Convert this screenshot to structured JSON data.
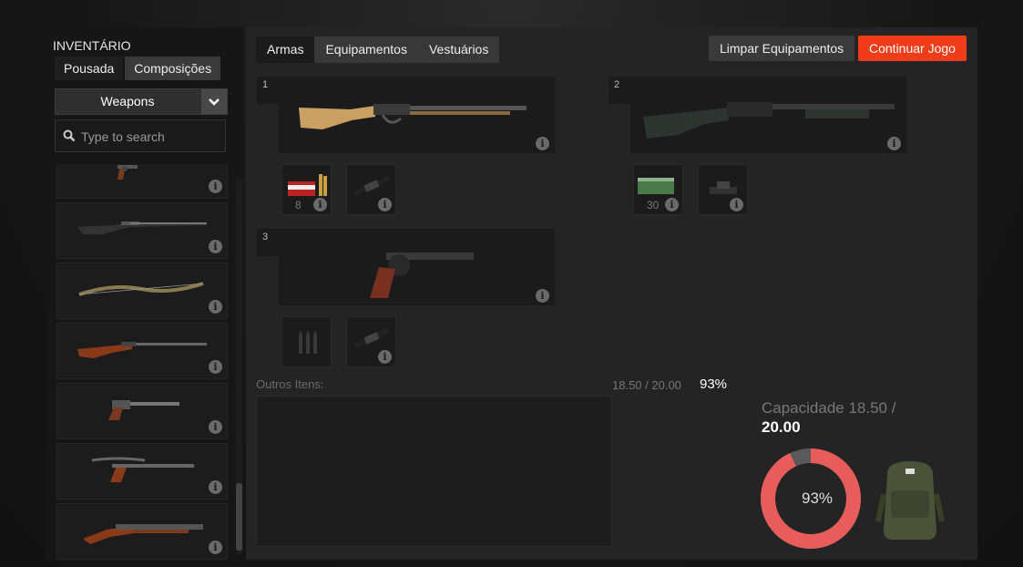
{
  "sidebar": {
    "title": "INVENTÁRIO",
    "tabs": [
      {
        "label": "Pousada",
        "active": false
      },
      {
        "label": "Composições",
        "active": true
      }
    ],
    "category": {
      "selected": "Weapons"
    },
    "search": {
      "placeholder": "Type to search",
      "value": ""
    },
    "items": [
      {
        "icon": "revolver-icon"
      },
      {
        "icon": "bolt-action-rifle-icon"
      },
      {
        "icon": "recurve-bow-icon"
      },
      {
        "icon": "hunting-rifle-icon"
      },
      {
        "icon": "single-shot-pistol-icon"
      },
      {
        "icon": "crossbow-pistol-icon"
      },
      {
        "icon": "double-barrel-shotgun-icon"
      }
    ]
  },
  "tabs": [
    {
      "label": "Armas",
      "active": true
    },
    {
      "label": "Equipamentos",
      "active": false
    },
    {
      "label": "Vestuários",
      "active": false
    }
  ],
  "actions": {
    "clear_label": "Limpar Equipamentos",
    "continue_label": "Continuar Jogo"
  },
  "slots": [
    {
      "number": "1",
      "weapon_icon": "lever-action-rifle-icon",
      "attachments": [
        {
          "icon": "ammo-box-icon",
          "count": "8"
        },
        {
          "icon": "rifle-scope-icon",
          "count": ""
        }
      ]
    },
    {
      "number": "2",
      "weapon_icon": "pump-shotgun-icon",
      "attachments": [
        {
          "icon": "shotgun-shells-icon",
          "count": "30"
        },
        {
          "icon": "red-dot-sight-icon",
          "count": ""
        }
      ]
    },
    {
      "number": "3",
      "weapon_icon": "revolver-icon",
      "attachments": [
        {
          "icon": "empty-ammo-slot-icon",
          "count": ""
        },
        {
          "icon": "pistol-scope-icon",
          "count": ""
        }
      ]
    }
  ],
  "others": {
    "label": "Outros Itens:"
  },
  "weight": {
    "text": "18.50 / 20.00",
    "percent_text": "93%"
  },
  "capacity": {
    "label": "Capacidade 18.50 /",
    "max": "20.00",
    "percent": 93,
    "percent_text": "93%"
  },
  "colors": {
    "accent": "#f03c18",
    "donut_fill": "#e85c5c",
    "donut_track": "#5a5a5a"
  }
}
